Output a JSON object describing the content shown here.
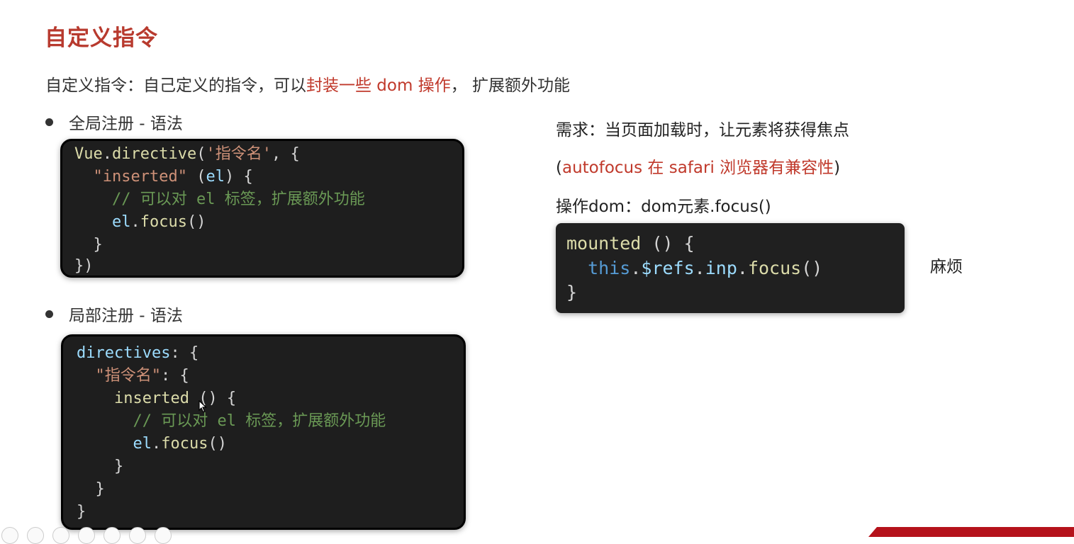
{
  "slide": {
    "title": "自定义指令",
    "subtitle_prefix": "自定义指令：自己定义的指令，可以",
    "subtitle_highlight": "封装一些 dom 操作",
    "subtitle_suffix": "， 扩展额外功能",
    "bullet_global": "全局注册 - 语法",
    "bullet_local": "局部注册 - 语法"
  },
  "global_code": {
    "l1_a": "Vue",
    "l1_b": ".",
    "l1_c": "directive",
    "l1_d": "(",
    "l1_e": "'指令名'",
    "l1_f": ", {",
    "l2_a": "\"inserted\"",
    "l2_b": " (",
    "l2_c": "el",
    "l2_d": ") {",
    "l3": "// 可以对 el 标签，扩展额外功能",
    "l4_a": "el",
    "l4_b": ".",
    "l4_c": "focus",
    "l4_d": "()",
    "l5": "}",
    "l6": "})"
  },
  "local_code": {
    "l1_a": "directives",
    "l1_b": ": {",
    "l2_a": "\"指令名\"",
    "l2_b": ": {",
    "l3_a": "inserted",
    "l3_b": " () {",
    "l4": "// 可以对 el 标签，扩展额外功能",
    "l5_a": "el",
    "l5_b": ".",
    "l5_c": "focus",
    "l5_d": "()",
    "l6": "}",
    "l7": "}",
    "l8": "}"
  },
  "right": {
    "requirement": "需求：当页面加载时，让元素将获得焦点",
    "note_open": "(",
    "note_red": "autofocus 在 safari 浏览器有兼容性",
    "note_close": ")",
    "operate": "操作dom：dom元素.focus()",
    "side_note": "麻烦"
  },
  "mounted_code": {
    "l1_a": "mounted",
    "l1_b": " () {",
    "l2_a": "this",
    "l2_b": ".",
    "l2_c": "$refs",
    "l2_d": ".",
    "l2_e": "inp",
    "l2_f": ".",
    "l2_g": "focus",
    "l2_h": "()",
    "l3": "}"
  },
  "icons": {
    "cursor": "mouse-pointer-icon"
  }
}
